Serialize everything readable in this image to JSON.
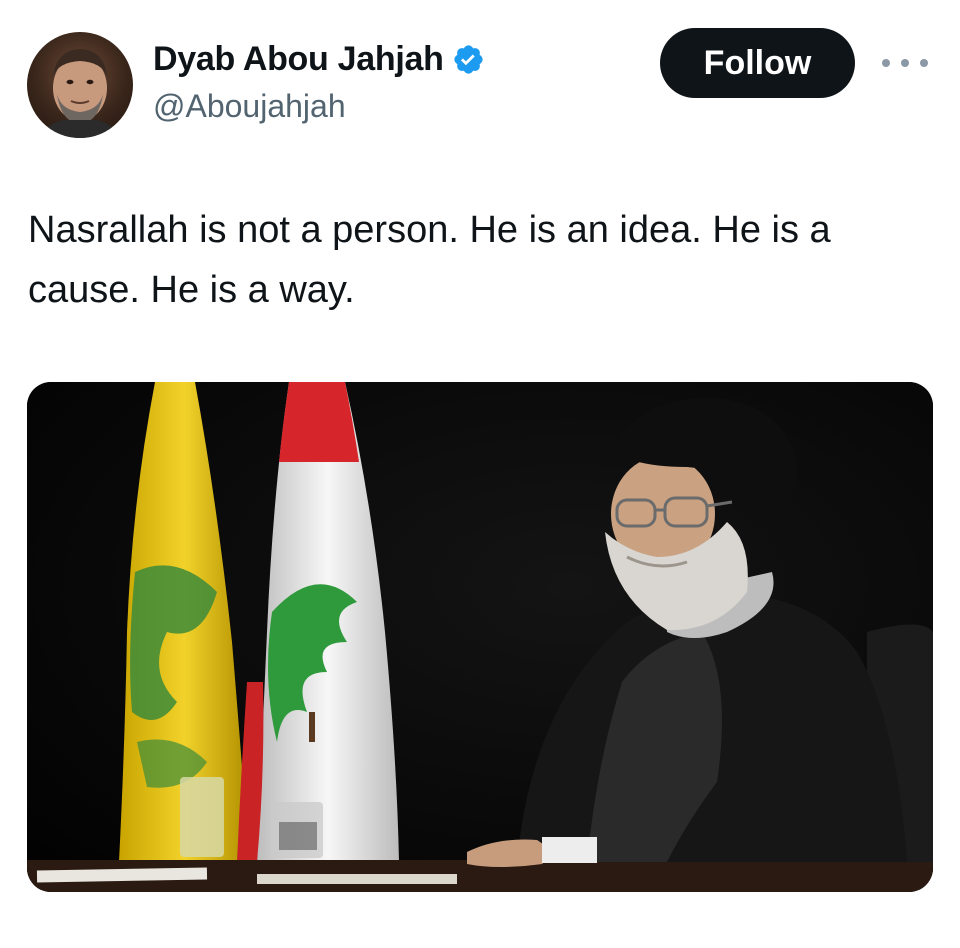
{
  "author": {
    "name": "Dyab Abou Jahjah",
    "handle": "@Aboujahjah",
    "verified": true,
    "verified_color": "#1d9bf0"
  },
  "actions": {
    "follow_label": "Follow",
    "more_icon": "more-horizontal-icon"
  },
  "tweet": {
    "text": "Nasrallah is not a person. He is an idea. He is a cause. He is a way."
  },
  "media": {
    "type": "photo"
  },
  "colors": {
    "text_primary": "#0f1419",
    "text_secondary": "#536471",
    "follow_button_bg": "#0f1419"
  }
}
